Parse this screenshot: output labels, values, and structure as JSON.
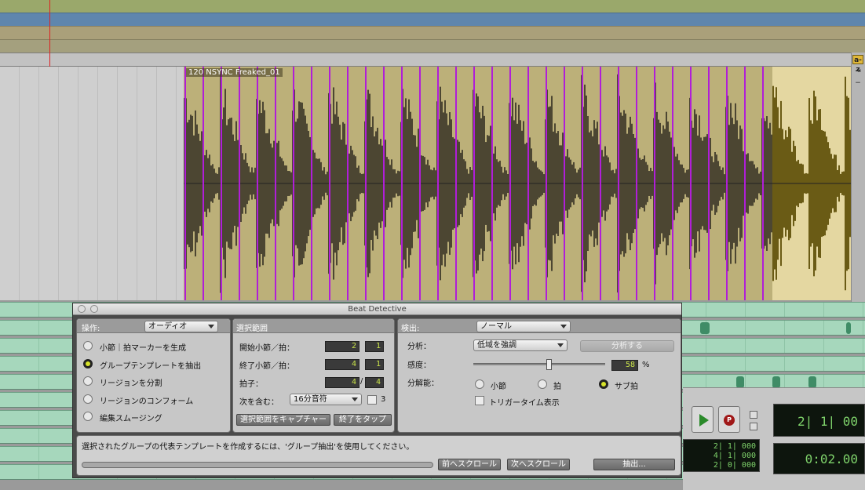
{
  "region": {
    "name": "120 NSYNC Freaked_01"
  },
  "dialog": {
    "title": "Beat Detective",
    "operation": {
      "label": "操作:",
      "selected": "オーディオ",
      "options": [
        "小節｜拍マーカーを生成",
        "グループテンプレートを抽出",
        "リージョンを分割",
        "リージョンのコンフォーム",
        "編集スムージング"
      ],
      "selected_index": 1
    },
    "selection": {
      "header": "選択範囲",
      "start_label": "開始小節／拍：",
      "start_bar": "2",
      "start_beat": "1",
      "end_label": "終了小節／拍：",
      "end_bar": "4",
      "end_beat": "1",
      "meter_label": "拍子：",
      "meter_num": "4",
      "meter_sep": "/",
      "meter_den": "4",
      "contains_label": "次を含む：",
      "contains_value": "16分音符",
      "triplet_label": "3",
      "capture_button": "選択範囲をキャプチャー",
      "tap_end_button": "終了をタップ"
    },
    "detection": {
      "label": "検出:",
      "mode": "ノーマル",
      "analysis_label": "分析：",
      "analysis_value": "低域を強調",
      "analyze_button": "分析する",
      "sensitivity_label": "感度：",
      "sensitivity_value": "58",
      "sensitivity_percent": 58,
      "sensitivity_unit": "%",
      "resolution_label": "分解能：",
      "resolution_options": [
        "小節",
        "拍",
        "サブ拍"
      ],
      "resolution_selected": 2,
      "trigger_label": "トリガータイム表示"
    },
    "status_text": "選択されたグループの代表テンプレートを作成するには、'グループ抽出'を使用してください。",
    "scroll_prev": "前へスクロール",
    "scroll_next": "次へスクロール",
    "extract_button": "抽出..."
  },
  "transport": {
    "counter_lines": [
      "2| 1| 000",
      "4| 1| 000",
      "2| 0| 000"
    ],
    "main_counter": "2| 1| 00",
    "time_counter": "0:02.00",
    "record_symbol": "P"
  },
  "side_buttons": [
    "a-z",
    "⇥",
    "−"
  ],
  "colors": {
    "region_light": "#bcb079",
    "waveform_dark": "#4c4632",
    "beat_marker": "#b01ed8",
    "green_track": "#a6d7bc",
    "lcd_green": "#7fd36b"
  }
}
